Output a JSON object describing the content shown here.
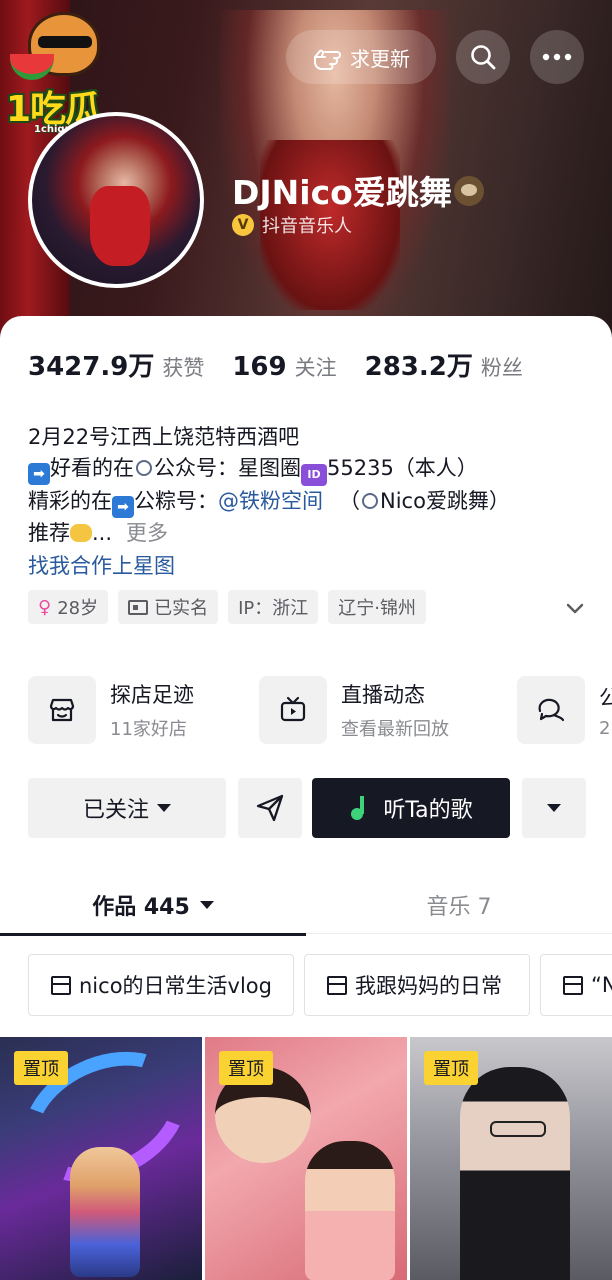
{
  "header": {
    "logo_text": "1吃瓜",
    "logo_sub": "1chigua.one",
    "update_label": "求更新"
  },
  "profile": {
    "name": "DJNico爱跳舞",
    "verified_label": "抖音音乐人",
    "verified_badge": "V"
  },
  "stats": [
    {
      "value": "3427.9万",
      "label": "获赞"
    },
    {
      "value": "169",
      "label": "关注"
    },
    {
      "value": "283.2万",
      "label": "粉丝"
    }
  ],
  "bio": {
    "line1": "2月22号江西上饶范特西酒吧",
    "line2_a": "好看的在",
    "line2_b": "公众号：星图圈",
    "line2_id": "ID",
    "line2_c": "55235（本人）",
    "line3_a": "精彩的在",
    "line3_b": "公粽号：",
    "line3_link": "@铁粉空间",
    "line3_c": "（",
    "line3_d": "Nico爱跳舞）",
    "line4": "推荐",
    "line4_ellipsis": "...",
    "more": "更多",
    "cooperate": "找我合作上星图"
  },
  "tags": {
    "age": "28岁",
    "realname": "已实名",
    "ip": "IP：浙江",
    "location": "辽宁·锦州"
  },
  "services": [
    {
      "title": "探店足迹",
      "sub": "11家好店",
      "icon": "shop-icon"
    },
    {
      "title": "直播动态",
      "sub": "查看最新回放",
      "icon": "tv-icon"
    },
    {
      "title": "公",
      "sub": "2",
      "icon": "chat-icon"
    }
  ],
  "actions": {
    "follow": "已关注",
    "music": "听Ta的歌"
  },
  "tabs": {
    "works_label": "作品",
    "works_count": "445",
    "music_label": "音乐",
    "music_count": "7"
  },
  "collections": [
    "nico的日常生活vlog",
    "我跟妈妈的日常",
    "“N"
  ],
  "videos": [
    {
      "pin": "置顶"
    },
    {
      "pin": "置顶"
    },
    {
      "pin": "置顶"
    }
  ]
}
